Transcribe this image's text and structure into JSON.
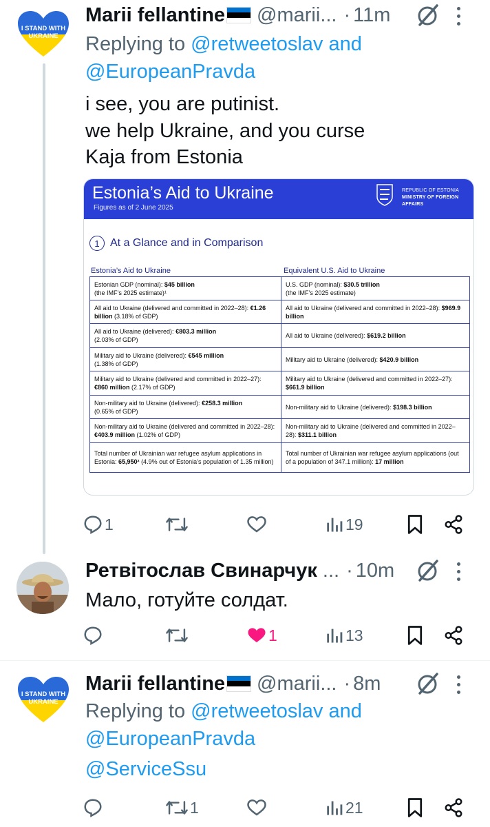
{
  "tweets": [
    {
      "author": "Marii fellantine",
      "handle": "@marii...",
      "time": "11m",
      "avatar_text": [
        "I STAND WITH",
        "UKRAINE"
      ],
      "reply_prefix": "Replying to",
      "reply_mentions": [
        "@retweetoslav",
        "and",
        "@EuropeanPravda"
      ],
      "text_lines": [
        "i see, you are putinist.",
        "we help Ukraine, and you curse",
        "Kaja from Estonia"
      ],
      "counts": {
        "replies": "1",
        "retweets": "",
        "likes": "",
        "views": "19"
      }
    },
    {
      "author": "Ретвітослав Свинарчук",
      "handle": "...",
      "time": "10m",
      "text_lines": [
        "Мало, готуйте солдат."
      ],
      "counts": {
        "replies": "",
        "retweets": "",
        "likes": "1",
        "views": "13"
      }
    },
    {
      "author": "Marii fellantine",
      "handle": "@marii...",
      "time": "8m",
      "avatar_text": [
        "I STAND WITH",
        "UKRAINE"
      ],
      "reply_prefix": "Replying to",
      "reply_mentions": [
        "@retweetoslav",
        "and",
        "@EuropeanPravda",
        "@ServiceSsu"
      ],
      "counts": {
        "replies": "",
        "retweets": "1",
        "likes": "",
        "views": "21"
      }
    }
  ],
  "infographic": {
    "title": "Estonia’s Aid to Ukraine",
    "subtitle": "Figures as of 2 June 2025",
    "ministry_line1": "REPUBLIC OF ESTONIA",
    "ministry_line2": "MINISTRY OF FOREIGN AFFAIRS",
    "section_number": "1",
    "section_title": "At a Glance and in Comparison",
    "col_left": "Estonia’s Aid to Ukraine",
    "col_right": "Equivalent U.S. Aid to Ukraine",
    "rows": [
      {
        "l1": "Estonian GDP (nominal): ",
        "lb": "$45 billion",
        "l2": "(the IMF’s 2025 estimate)¹",
        "r1": "U.S. GDP (nominal): ",
        "rb": "$30.5 trillion",
        "r2": "(the IMF’s 2025 estimate)"
      },
      {
        "l1": "All aid to Ukraine (delivered and committed in 2022–28): ",
        "lb": "€1.26 billion",
        "l2": " (3.18% of GDP)",
        "r1": "All aid to Ukraine (delivered and committed in 2022–28): ",
        "rb": "$969.9 billion",
        "r2": ""
      },
      {
        "l1": "All aid to Ukraine (delivered): ",
        "lb": "€803.3 million",
        "l2": "(2.03% of GDP)",
        "r1": "All aid to Ukraine (delivered): ",
        "rb": "$619.2 billion",
        "r2": ""
      },
      {
        "l1": "Military aid to Ukraine (delivered): ",
        "lb": "€545 million",
        "l2": "(1.38% of GDP)",
        "r1": "Military aid to Ukraine (delivered): ",
        "rb": "$420.9 billion",
        "r2": ""
      },
      {
        "l1": "Military aid to Ukraine (delivered and committed in 2022–27): ",
        "lb": "€860 million",
        "l2": " (2.17% of GDP)",
        "r1": "Military aid to Ukraine (delivered and committed in 2022–27): ",
        "rb": "$661.9 billion",
        "r2": ""
      },
      {
        "l1": "Non-military aid to Ukraine (delivered): ",
        "lb": "€258.3 million",
        "l2": "(0.65% of GDP)",
        "r1": "Non-military aid to Ukraine (delivered): ",
        "rb": "$198.3 billion",
        "r2": ""
      },
      {
        "l1": "Non-military aid to Ukraine (delivered and committed in 2022–28): ",
        "lb": "€403.9 million",
        "l2": " (1.02% of GDP)",
        "r1": "Non-military aid to Ukraine (delivered and committed in 2022–28): ",
        "rb": "$311.1 billion",
        "r2": ""
      },
      {
        "l1": "Total number of Ukrainian war refugee asylum applications in Estonia: ",
        "lb": "65,950²",
        "l2": " (4.9% out of Estonia’s population of 1.35 million)",
        "r1": "Total number of Ukrainian war refugee asylum applications (out of a population of 347.1 million): ",
        "rb": "17 million",
        "r2": ""
      }
    ]
  },
  "colors": {
    "accent_blue": "#1d9bf0",
    "secondary_text": "#536471",
    "like_pink": "#f91880",
    "infographic_blue": "#2a3fd6",
    "flag_blue": "#0072ce",
    "flag_black": "#000000",
    "flag_white": "#ffffff",
    "ukraine_blue": "#2a6ad8",
    "ukraine_yellow": "#ffd500"
  },
  "icons": [
    "reply-icon",
    "retweet-icon",
    "like-icon",
    "views-icon",
    "bookmark-icon",
    "share-icon",
    "grok-icon",
    "more-icon",
    "estonia-flag-icon",
    "estonia-crest-icon"
  ]
}
